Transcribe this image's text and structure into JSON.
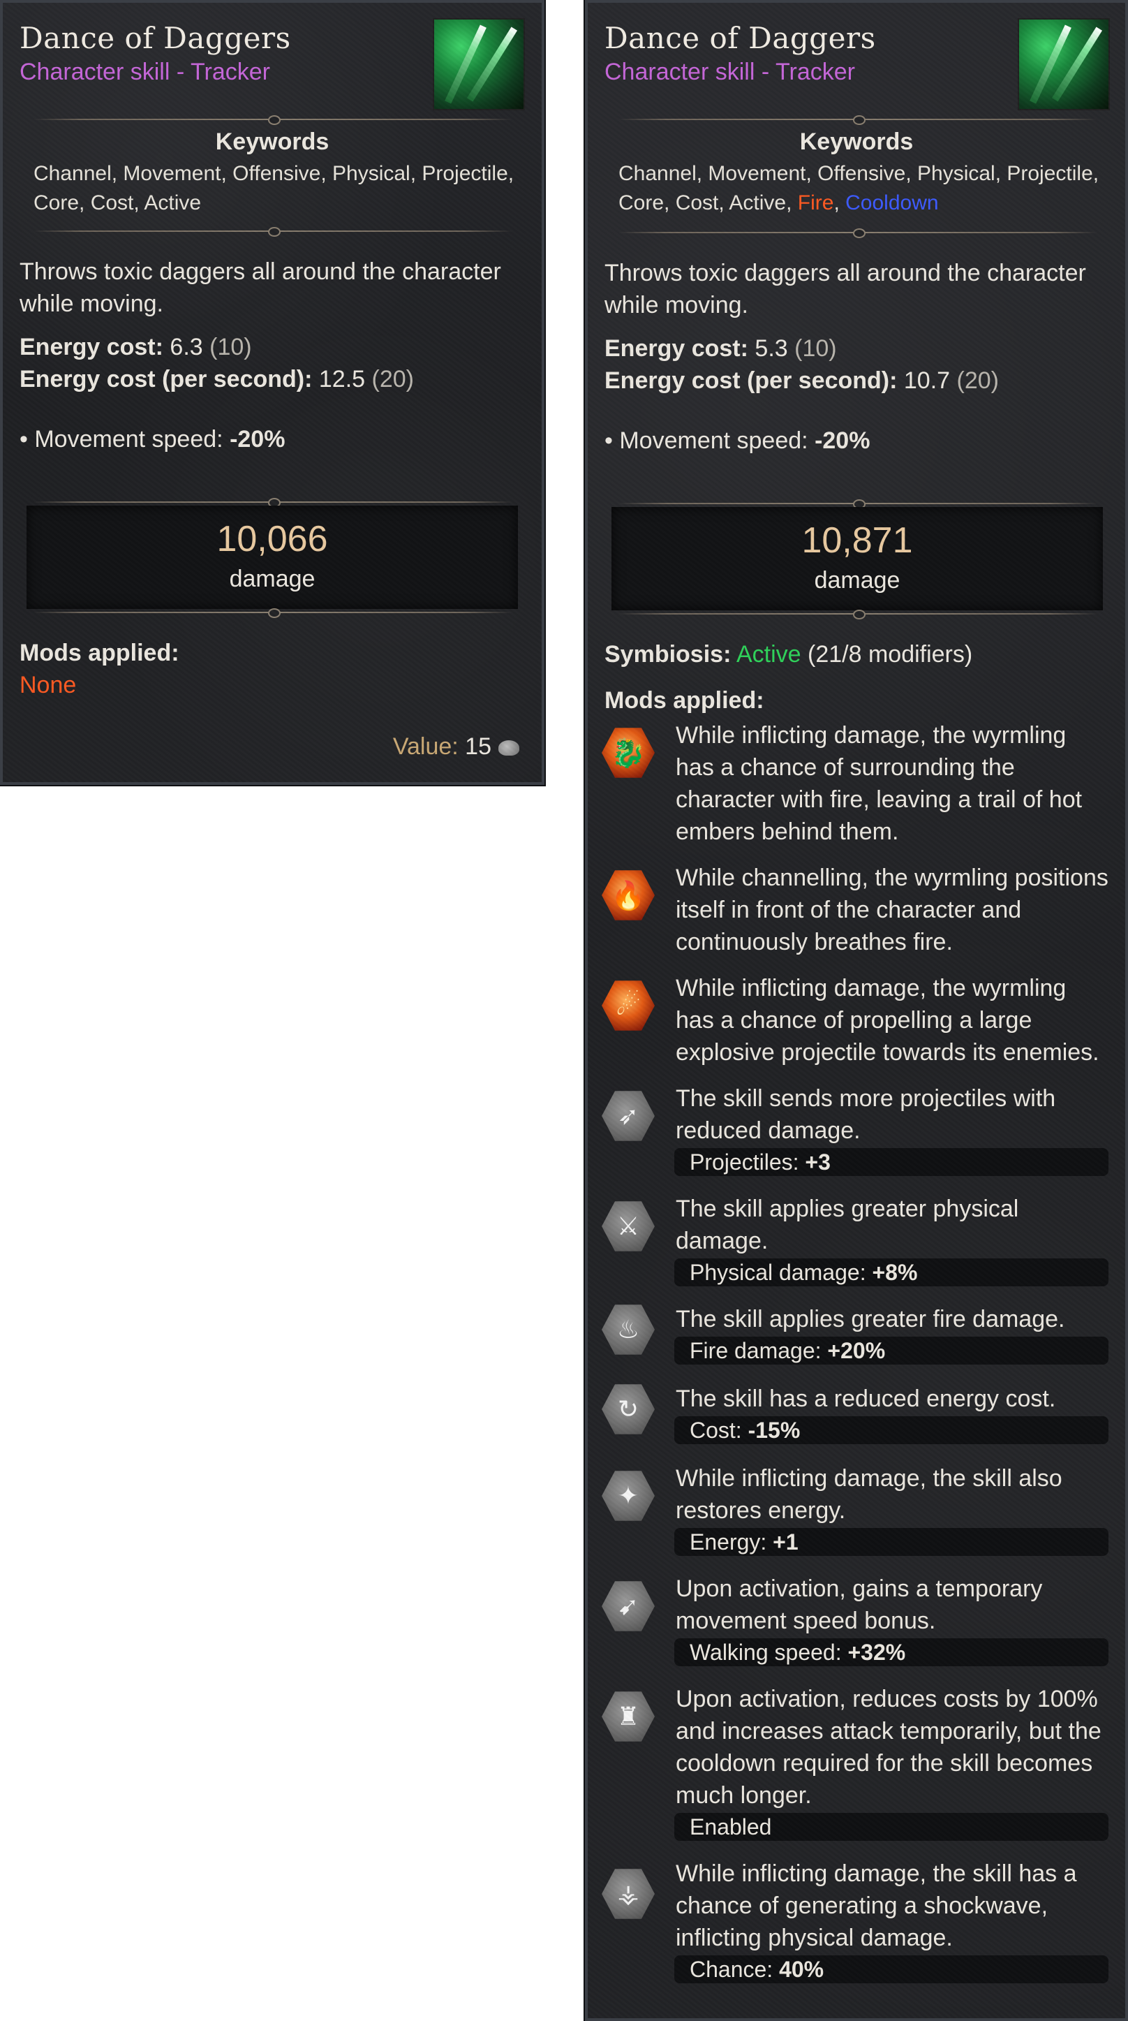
{
  "left_card": {
    "title": "Dance of Daggers",
    "subtitle": "Character skill - Tracker",
    "keywords_title": "Keywords",
    "keywords_line1": "Channel, Movement, Offensive, Physical, Projectile,",
    "keywords_line2": "Core, Cost, Active",
    "description": "Throws toxic daggers all around the character while moving.",
    "energy_cost_label": "Energy cost:",
    "energy_cost_value": "6.3",
    "energy_cost_base": "(10)",
    "energy_cost_ps_label": "Energy cost (per second):",
    "energy_cost_ps_value": "12.5",
    "energy_cost_ps_base": "(20)",
    "movement_label": "• Movement speed:",
    "movement_value": "-20%",
    "damage_value": "10,066",
    "damage_label": "damage",
    "mods_label": "Mods applied:",
    "mods_none": "None",
    "value_label": "Value:",
    "value_number": "15"
  },
  "right_card": {
    "title": "Dance of Daggers",
    "subtitle": "Character skill - Tracker",
    "keywords_title": "Keywords",
    "keywords_line1": "Channel, Movement, Offensive, Physical, Projectile,",
    "keywords_line2": "Core, Cost, Active,",
    "keyword_fire": "Fire",
    "keyword_sep": ",",
    "keyword_cooldown": "Cooldown",
    "description": "Throws toxic daggers all around the character while moving.",
    "energy_cost_label": "Energy cost:",
    "energy_cost_value": "5.3",
    "energy_cost_base": "(10)",
    "energy_cost_ps_label": "Energy cost (per second):",
    "energy_cost_ps_value": "10.7",
    "energy_cost_ps_base": "(20)",
    "movement_label": "• Movement speed:",
    "movement_value": "-20%",
    "damage_value": "10,871",
    "damage_label": "damage",
    "symbiosis_label": "Symbiosis:",
    "symbiosis_status": "Active",
    "symbiosis_detail": "(21/8 modifiers)",
    "mods_label": "Mods applied:",
    "mods": [
      {
        "icon": "fire-serpent-icon",
        "text": "While inflicting damage, the wyrmling has a chance of surrounding the character with fire, leaving a trail of hot embers behind them."
      },
      {
        "icon": "fire-breath-icon",
        "text": "While channelling, the wyrmling positions itself in front of the character and continuously breathes fire."
      },
      {
        "icon": "fire-projectile-icon",
        "text": "While inflicting damage, the wyrmling has a chance of propelling a large explosive projectile towards its enemies."
      },
      {
        "icon": "projectiles-icon",
        "text": "The skill sends more projectiles with reduced damage.",
        "bar_label": "Projectiles:",
        "bar_value": "+3"
      },
      {
        "icon": "physical-damage-icon",
        "text": "The skill applies greater physical damage.",
        "bar_label": "Physical damage:",
        "bar_value": "+8%"
      },
      {
        "icon": "fire-damage-icon",
        "text": "The skill applies greater fire damage.",
        "bar_label": "Fire damage:",
        "bar_value": "+20%"
      },
      {
        "icon": "energy-cost-icon",
        "text": "The skill has a reduced energy cost.",
        "bar_label": "Cost:",
        "bar_value": "-15%"
      },
      {
        "icon": "energy-restore-icon",
        "text": "While inflicting damage, the skill also restores energy.",
        "bar_label": "Energy:",
        "bar_value": "+1"
      },
      {
        "icon": "movement-speed-icon",
        "text": "Upon activation, gains a temporary movement speed bonus.",
        "bar_label": "Walking speed:",
        "bar_value": "+32%"
      },
      {
        "icon": "cost-reduction-icon",
        "text": "Upon activation, reduces costs by 100% and increases attack temporarily, but the cooldown required for the skill becomes much longer.",
        "bar_label": "Enabled",
        "bar_value": ""
      },
      {
        "icon": "shockwave-icon",
        "text": "While inflicting damage, the skill has a chance of generating a shockwave, inflicting physical damage.",
        "bar_label": "Chance:",
        "bar_value": "40%"
      }
    ]
  },
  "colors": {
    "title": "#f1ece3",
    "subtitle": "#c566d8",
    "damage": "#e8c9a0",
    "none": "#ff5a22",
    "fire": "#ff5a22",
    "cooldown": "#3d5bff",
    "active": "#2fd25a",
    "value": "#c9a874"
  }
}
